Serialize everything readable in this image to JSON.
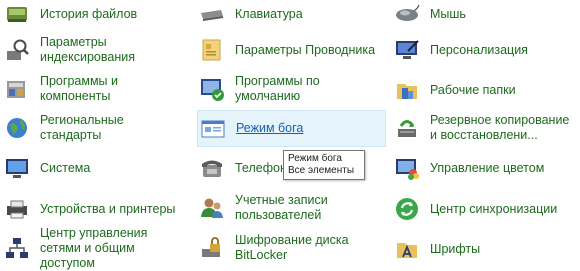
{
  "items": [
    {
      "label": "История файлов",
      "icon": "file-history-icon"
    },
    {
      "label": "Клавиатура",
      "icon": "keyboard-icon"
    },
    {
      "label": "Мышь",
      "icon": "mouse-icon"
    },
    {
      "label": "Параметры индексирования",
      "icon": "indexing-options-icon"
    },
    {
      "label": "Параметры Проводника",
      "icon": "explorer-options-icon"
    },
    {
      "label": "Персонализация",
      "icon": "personalization-icon"
    },
    {
      "label": "Программы и компоненты",
      "icon": "programs-features-icon"
    },
    {
      "label": "Программы по умолчанию",
      "icon": "default-programs-icon"
    },
    {
      "label": "Рабочие папки",
      "icon": "work-folders-icon"
    },
    {
      "label": "Региональные стандарты",
      "icon": "region-icon"
    },
    {
      "label": "Режим бога",
      "icon": "god-mode-icon"
    },
    {
      "label": "Резервное копирование и восстановлени...",
      "icon": "backup-restore-icon"
    },
    {
      "label": "Система",
      "icon": "system-icon"
    },
    {
      "label": "Телефон",
      "icon": "phone-modem-icon"
    },
    {
      "label": "Управление цветом",
      "icon": "color-management-icon"
    },
    {
      "label": "Устройства и принтеры",
      "icon": "devices-printers-icon"
    },
    {
      "label": "Учетные записи пользователей",
      "icon": "user-accounts-icon"
    },
    {
      "label": "Центр синхронизации",
      "icon": "sync-center-icon"
    },
    {
      "label": "Центр управления сетями и общим доступом",
      "icon": "network-sharing-icon"
    },
    {
      "label": "Шифрование диска BitLocker",
      "icon": "bitlocker-icon"
    },
    {
      "label": "Шрифты",
      "icon": "fonts-icon"
    }
  ],
  "tooltip": {
    "line1": "Режим бога",
    "line2": "Все элементы"
  }
}
